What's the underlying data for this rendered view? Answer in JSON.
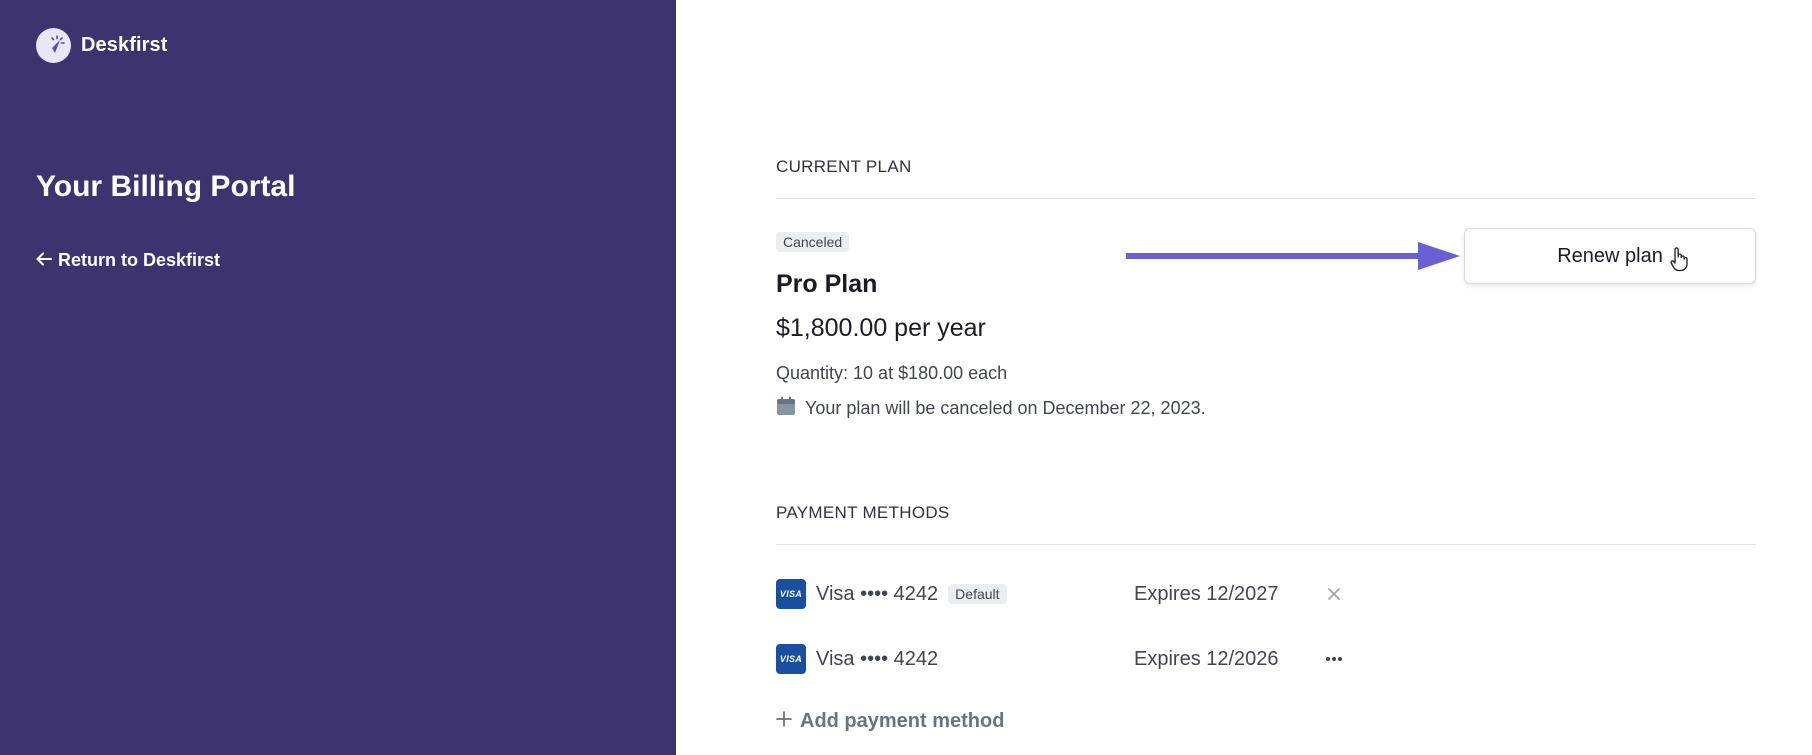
{
  "sidebar": {
    "brand_name": "Deskfirst",
    "logo_icon": "compass-icon",
    "portal_title": "Your Billing Portal",
    "return_link": "Return to Deskfirst",
    "background": "#3d336e"
  },
  "current_plan": {
    "heading": "CURRENT PLAN",
    "status_badge": "Canceled",
    "plan_name": "Pro Plan",
    "price": "$1,800.00 per year",
    "quantity": "Quantity: 10 at $180.00 each",
    "cancel_notice": "Your plan will be canceled on December 22, 2023.",
    "renew_button": "Renew plan",
    "arrow_color": "#6c5fd6"
  },
  "payment_methods": {
    "heading": "PAYMENT METHODS",
    "items": [
      {
        "brand": "VISA",
        "label": "Visa •••• 4242",
        "badge": "Default",
        "expiry": "Expires 12/2027",
        "action_icon": "close-icon"
      },
      {
        "brand": "VISA",
        "label": "Visa •••• 4242",
        "badge": "",
        "expiry": "Expires 12/2026",
        "action_icon": "more-icon"
      }
    ],
    "add_label": "Add payment method"
  }
}
